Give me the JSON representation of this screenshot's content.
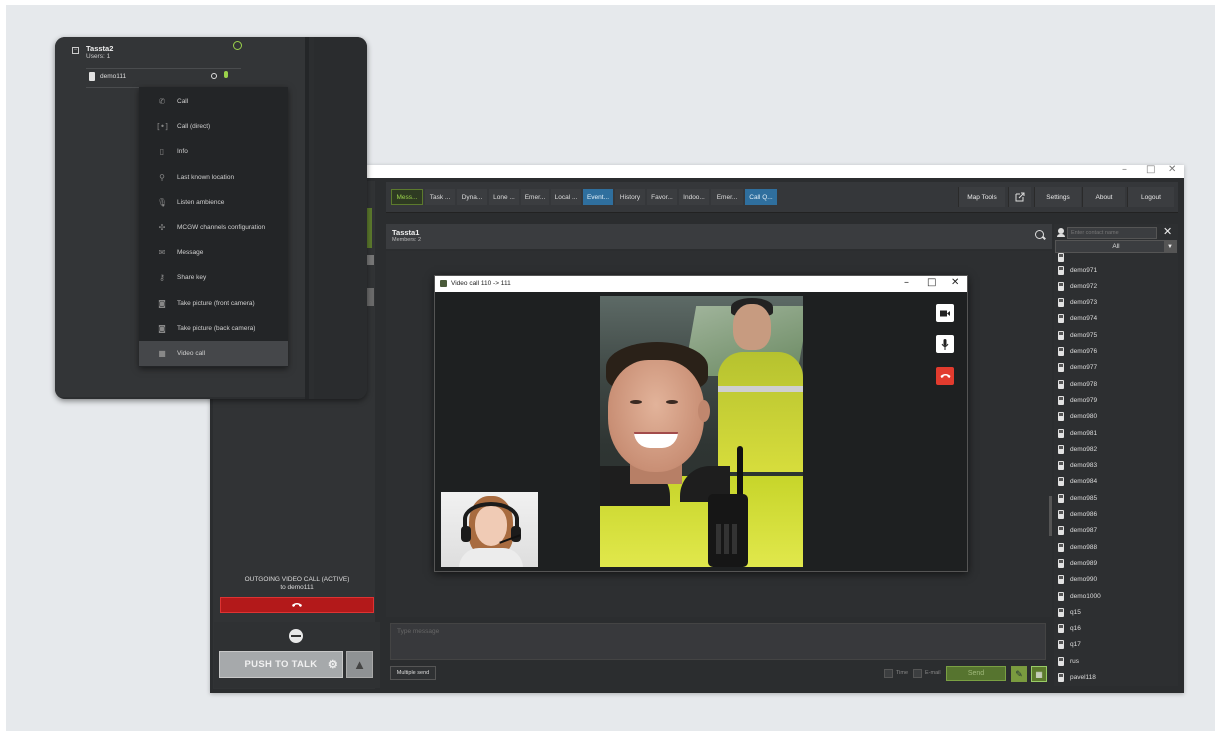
{
  "main_window": {
    "controls": {
      "minimize": "–",
      "maximize": "□",
      "close": "✕"
    }
  },
  "toolbar": {
    "tabs": [
      {
        "label": "Mess...",
        "style": "green"
      },
      {
        "label": "Task ...",
        "style": "normal"
      },
      {
        "label": "Dyna...",
        "style": "normal"
      },
      {
        "label": "Lone ...",
        "style": "normal"
      },
      {
        "label": "Emer...",
        "style": "normal"
      },
      {
        "label": "Local ...",
        "style": "normal"
      },
      {
        "label": "Event...",
        "style": "blue"
      },
      {
        "label": "History",
        "style": "normal"
      },
      {
        "label": "Favor...",
        "style": "normal"
      },
      {
        "label": "Indoo...",
        "style": "normal"
      },
      {
        "label": "Emer...",
        "style": "normal"
      },
      {
        "label": "Call Q...",
        "style": "blue"
      }
    ],
    "map_tools": "Map Tools",
    "settings": "Settings",
    "about": "About",
    "logout": "Logout"
  },
  "chat": {
    "title": "Tassta1",
    "members": "Members: 2",
    "input_placeholder": "Type message",
    "multiple_send": "Multiple send",
    "time_label": "Time",
    "email_label": "E-mail",
    "send": "Send"
  },
  "contacts": {
    "search_placeholder": "Enter contact name",
    "filter": "All",
    "items": [
      "demo971",
      "demo972",
      "demo973",
      "demo974",
      "demo975",
      "demo976",
      "demo977",
      "demo978",
      "demo979",
      "demo980",
      "demo981",
      "demo982",
      "demo983",
      "demo984",
      "demo985",
      "demo986",
      "demo987",
      "demo988",
      "demo989",
      "demo990",
      "demo1000",
      "q15",
      "q16",
      "q17",
      "rus",
      "pavel118"
    ]
  },
  "call_panel": {
    "status_line1": "OUTGOING VIDEO CALL (ACTIVE)",
    "status_line2": "to demo111",
    "push_to_talk": "PUSH TO TALK"
  },
  "video_dialog": {
    "title": "Video call 110 -> 111",
    "controls": {
      "minimize": "–",
      "maximize": "□",
      "close": "✕"
    }
  },
  "sidebar": {
    "group_name": "Tassta2",
    "group_users": "Users: 1",
    "user": "demo111"
  },
  "context_menu": {
    "items": [
      {
        "label": "Call",
        "icon": "phone-icon",
        "glyph": "✆"
      },
      {
        "label": "Call (direct)",
        "icon": "direct-call-icon",
        "glyph": "[•]"
      },
      {
        "label": "Info",
        "icon": "device-info-icon",
        "glyph": "▯"
      },
      {
        "label": "Last known location",
        "icon": "location-pin-icon",
        "glyph": "⚲"
      },
      {
        "label": "Listen ambience",
        "icon": "microphone-icon",
        "glyph": "🎙"
      },
      {
        "label": "MCGW channels configuration",
        "icon": "channels-config-icon",
        "glyph": "✣"
      },
      {
        "label": "Message",
        "icon": "envelope-icon",
        "glyph": "✉"
      },
      {
        "label": "Share key",
        "icon": "key-icon",
        "glyph": "⚷"
      },
      {
        "label": "Take picture (front camera)",
        "icon": "camera-icon",
        "glyph": "◙"
      },
      {
        "label": "Take picture (back camera)",
        "icon": "camera-icon",
        "glyph": "◙"
      },
      {
        "label": "Video call",
        "icon": "video-camera-icon",
        "glyph": "■"
      }
    ]
  },
  "colors": {
    "accent_green": "#9bd24b",
    "tab_blue": "#2f6f9e",
    "end_call_red": "#b3191a",
    "hangup_red": "#e23b2e"
  }
}
